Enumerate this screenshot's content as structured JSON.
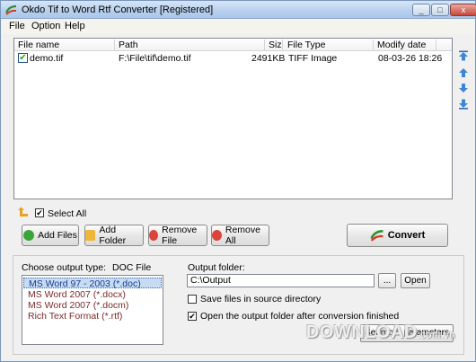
{
  "window": {
    "title": "Okdo Tif to Word Rtf Converter [Registered]",
    "minimize": "_",
    "maximize": "□",
    "close": "x"
  },
  "menu": {
    "items": [
      "File",
      "Option",
      "Help"
    ]
  },
  "files_table": {
    "columns": [
      "File name",
      "Path",
      "Size",
      "File Type",
      "Modify date"
    ],
    "rows": [
      {
        "checked": true,
        "name": "demo.tif",
        "path": "F:\\File\\tif\\demo.tif",
        "size": "2491KB",
        "type": "TIFF Image",
        "date": "08-03-26 18:26"
      }
    ]
  },
  "select_all": {
    "label": "Select All",
    "checked": true
  },
  "buttons": {
    "add_files": "Add Files",
    "add_folder": "Add Folder",
    "remove_file": "Remove File",
    "remove_all": "Remove All",
    "convert": "Convert"
  },
  "output": {
    "type_label": "Choose output type:",
    "type_value": "DOC File",
    "types": [
      "MS Word 97 - 2003 (*.doc)",
      "MS Word 2007 (*.docx)",
      "MS Word 2007 (*.docm)",
      "Rich Text Format (*.rtf)"
    ],
    "selected_index": 0,
    "folder_label": "Output folder:",
    "folder_value": "C:\\Output",
    "browse": "...",
    "open": "Open",
    "save_in_source": {
      "label": "Save files in source directory",
      "checked": false
    },
    "open_after": {
      "label": "Open the output folder after conversion finished",
      "checked": true
    },
    "more_params": "Set more parameters"
  },
  "watermark": {
    "text": "DOWNLOAD",
    "suffix": ".com.vn"
  },
  "colors": {
    "titlebar": "#b9d1ee",
    "selection": "#c7dcf3",
    "accent_green": "#3aa63a",
    "accent_red": "#d9453a"
  }
}
